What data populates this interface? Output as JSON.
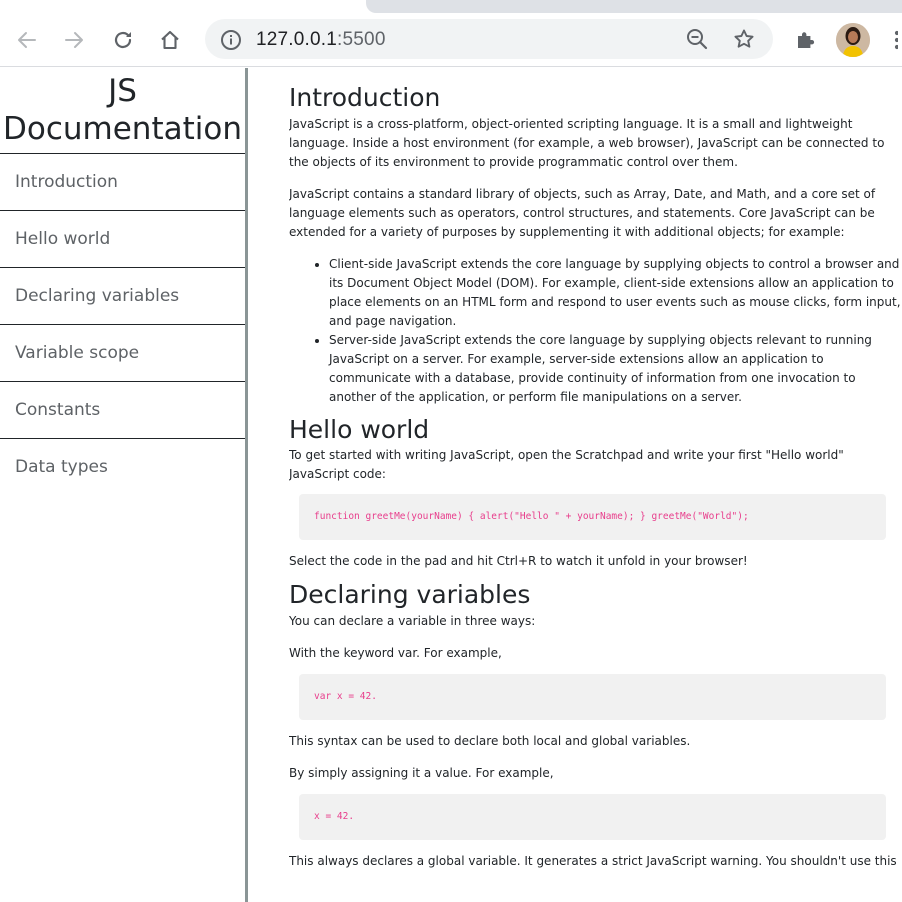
{
  "browser": {
    "url_host": "127.0.0.1",
    "url_port": ":5500"
  },
  "nav": {
    "title": "JS Documentation",
    "items": [
      {
        "label": "Introduction"
      },
      {
        "label": "Hello world"
      },
      {
        "label": "Declaring variables"
      },
      {
        "label": "Variable scope"
      },
      {
        "label": "Constants"
      },
      {
        "label": "Data types"
      }
    ]
  },
  "sections": {
    "introduction": {
      "heading": "Introduction",
      "p1": "JavaScript is a cross-platform, object-oriented scripting language. It is a small and lightweight language. Inside a host environment (for example, a web browser), JavaScript can be connected to the objects of its environment to provide programmatic control over them.",
      "p2": "JavaScript contains a standard library of objects, such as Array, Date, and Math, and a core set of language elements such as operators, control structures, and statements. Core JavaScript can be extended for a variety of purposes by supplementing it with additional objects; for example:",
      "list": [
        "Client-side JavaScript extends the core language by supplying objects to control a browser and its Document Object Model (DOM). For example, client-side extensions allow an application to place elements on an HTML form and respond to user events such as mouse clicks, form input, and page navigation.",
        "Server-side JavaScript extends the core language by supplying objects relevant to running JavaScript on a server. For example, server-side extensions allow an application to communicate with a database, provide continuity of information from one invocation to another of the application, or perform file manipulations on a server."
      ]
    },
    "hello_world": {
      "heading": "Hello world",
      "p1": "To get started with writing JavaScript, open the Scratchpad and write your first \"Hello world\" JavaScript code:",
      "code": "function greetMe(yourName) { alert(\"Hello \" + yourName); } greetMe(\"World\");",
      "p2": "Select the code in the pad and hit Ctrl+R to watch it unfold in your browser!"
    },
    "declaring_variables": {
      "heading": "Declaring variables",
      "p1": "You can declare a variable in three ways:",
      "p2": "With the keyword var. For example,",
      "code1": "var x = 42.",
      "p3": "This syntax can be used to declare both local and global variables.",
      "p4": "By simply assigning it a value. For example,",
      "code2": "x = 42.",
      "p5": "This always declares a global variable. It generates a strict JavaScript warning. You shouldn't use this"
    }
  },
  "colors": {
    "code_text": "#e83e8c",
    "code_bg": "#f1f1f1",
    "nav_border": "#8a9596"
  }
}
